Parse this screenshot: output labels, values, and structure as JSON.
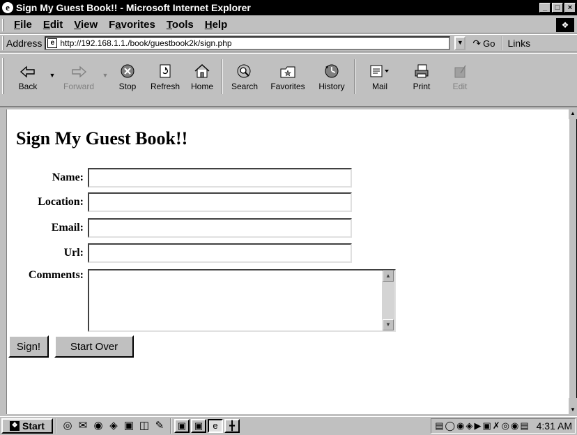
{
  "window": {
    "title": "Sign My Guest Book!! - Microsoft Internet Explorer",
    "controls": [
      "_",
      " ",
      "×"
    ]
  },
  "menubar": {
    "items": [
      {
        "label": "File",
        "accel": "F"
      },
      {
        "label": "Edit",
        "accel": "E"
      },
      {
        "label": "View",
        "accel": "V"
      },
      {
        "label": "Favorites",
        "accel": "a"
      },
      {
        "label": "Tools",
        "accel": "T"
      },
      {
        "label": "Help",
        "accel": "H"
      }
    ]
  },
  "addressbar": {
    "label": "Address",
    "url": "http://192.168.1.1./book/guestbook2k/sign.php",
    "go_label": "Go",
    "links_label": "Links"
  },
  "toolbar": {
    "buttons": [
      {
        "label": "Back",
        "icon": "back-arrow-icon",
        "enabled": true
      },
      {
        "label": "Forward",
        "icon": "forward-arrow-icon",
        "enabled": false
      },
      {
        "label": "Stop",
        "icon": "stop-icon",
        "enabled": true
      },
      {
        "label": "Refresh",
        "icon": "refresh-icon",
        "enabled": true
      },
      {
        "label": "Home",
        "icon": "home-icon",
        "enabled": true
      },
      {
        "label": "Search",
        "icon": "search-icon",
        "enabled": true
      },
      {
        "label": "Favorites",
        "icon": "favorites-icon",
        "enabled": true
      },
      {
        "label": "History",
        "icon": "history-icon",
        "enabled": true
      },
      {
        "label": "Mail",
        "icon": "mail-icon",
        "enabled": true
      },
      {
        "label": "Print",
        "icon": "print-icon",
        "enabled": true
      },
      {
        "label": "Edit",
        "icon": "edit-icon",
        "enabled": false
      }
    ]
  },
  "page": {
    "heading": "Sign My Guest Book!!",
    "fields": {
      "name": {
        "label": "Name:",
        "value": ""
      },
      "location": {
        "label": "Location:",
        "value": ""
      },
      "email": {
        "label": "Email:",
        "value": ""
      },
      "url": {
        "label": "Url:",
        "value": ""
      },
      "comments": {
        "label": "Comments:",
        "value": ""
      }
    },
    "buttons": {
      "sign": "Sign!",
      "start_over": "Start Over"
    }
  },
  "taskbar": {
    "start_label": "Start",
    "clock": "4:31 AM"
  },
  "colors": {
    "chrome": "#c0c0c0",
    "titlebar": "#000000",
    "page_background": "#ffffff"
  }
}
